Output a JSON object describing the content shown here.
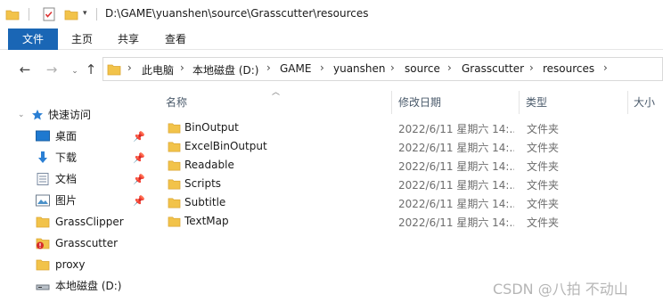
{
  "window": {
    "title": "D:\\GAME\\yuanshen\\source\\Grasscutter\\resources"
  },
  "ribbon": {
    "tabs": [
      {
        "label": "文件"
      },
      {
        "label": "主页"
      },
      {
        "label": "共享"
      },
      {
        "label": "查看"
      }
    ]
  },
  "address": {
    "crumbs": [
      {
        "label": "此电脑"
      },
      {
        "label": "本地磁盘 (D:)"
      },
      {
        "label": "GAME"
      },
      {
        "label": "yuanshen"
      },
      {
        "label": "source"
      },
      {
        "label": "Grasscutter"
      },
      {
        "label": "resources"
      }
    ]
  },
  "columns": {
    "name": "名称",
    "date": "修改日期",
    "type": "类型",
    "size": "大小"
  },
  "nav": {
    "quick_access": "快速访问",
    "items": [
      {
        "label": "桌面",
        "icon": "desktop-icon",
        "pinned": true
      },
      {
        "label": "下载",
        "icon": "download-icon",
        "pinned": true
      },
      {
        "label": "文档",
        "icon": "document-icon",
        "pinned": true
      },
      {
        "label": "图片",
        "icon": "picture-icon",
        "pinned": true
      },
      {
        "label": "GrassClipper",
        "icon": "folder-icon",
        "pinned": false
      },
      {
        "label": "Grasscutter",
        "icon": "folder-error-icon",
        "pinned": false
      },
      {
        "label": "proxy",
        "icon": "folder-icon",
        "pinned": false
      },
      {
        "label": "本地磁盘 (D:)",
        "icon": "drive-icon",
        "pinned": false
      }
    ]
  },
  "files": [
    {
      "name": "BinOutput",
      "date": "2022/6/11 星期六 14:...",
      "type": "文件夹"
    },
    {
      "name": "ExcelBinOutput",
      "date": "2022/6/11 星期六 14:...",
      "type": "文件夹"
    },
    {
      "name": "Readable",
      "date": "2022/6/11 星期六 14:...",
      "type": "文件夹"
    },
    {
      "name": "Scripts",
      "date": "2022/6/11 星期六 14:...",
      "type": "文件夹"
    },
    {
      "name": "Subtitle",
      "date": "2022/6/11 星期六 14:...",
      "type": "文件夹"
    },
    {
      "name": "TextMap",
      "date": "2022/6/11 星期六 14:...",
      "type": "文件夹"
    }
  ],
  "watermark": "CSDN @八拍 不动山",
  "colors": {
    "accent": "#1a66b5",
    "folder": "#f2c34a",
    "folder_dark": "#dba632"
  }
}
